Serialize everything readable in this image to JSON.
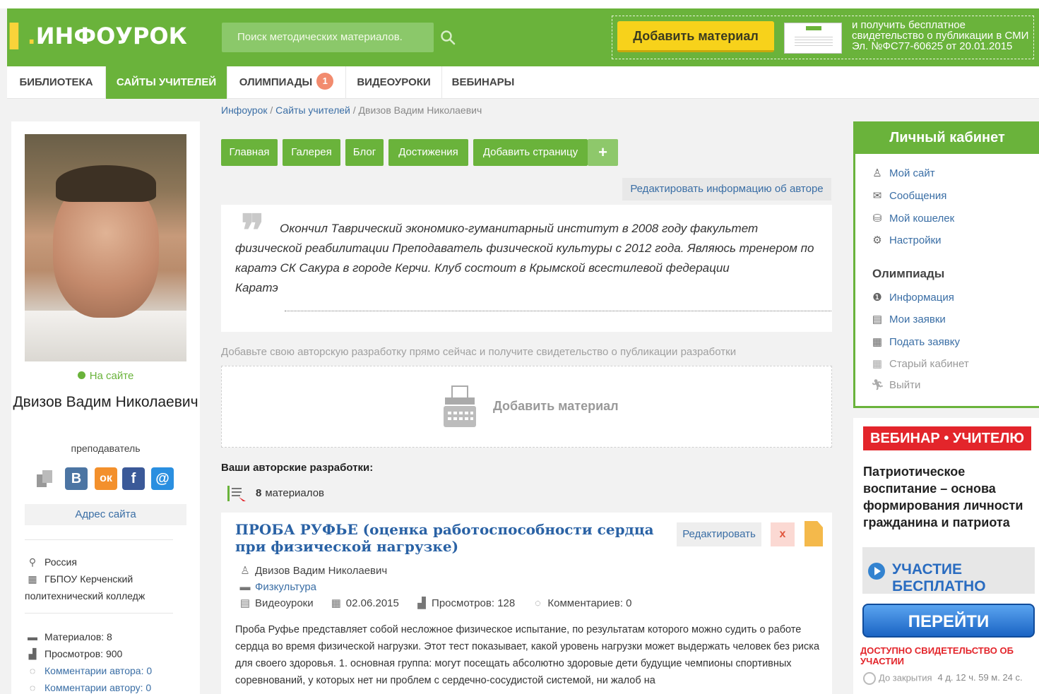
{
  "header": {
    "logo_main": "ИНФОУРОК",
    "search_placeholder": "Поиск методических материалов.",
    "add_material": "Добавить материал",
    "promo_text": "и получить бесплатное свидетельство о публикации в СМИ Эл. №ФС77-60625 от 20.01.2015"
  },
  "nav": {
    "items": [
      "БИБЛИОТЕКА",
      "САЙТЫ УЧИТЕЛЕЙ",
      "ОЛИМПИАДЫ",
      "ВИДЕОУРОКИ",
      "ВЕБИНАРЫ"
    ],
    "olymp_badge": "1"
  },
  "breadcrumb": {
    "home": "Инфоурок",
    "sep": "/",
    "sites": "Сайты учителей",
    "current": "Двизов Вадим Николаевич"
  },
  "profile": {
    "status": "На сайте",
    "name": "Двизов Вадим Николаевич",
    "role": "преподаватель",
    "social_vk": "В",
    "social_ok": "ок",
    "social_fb": "f",
    "social_mail": "@",
    "site_address": "Адрес сайта",
    "country": "Россия",
    "org": "ГБПОУ Керченский политехнический колледж",
    "materials": "Материалов: 8",
    "views": "Просмотров: 900",
    "author_comments": "Комментарии автора: 0",
    "comments_to_author": "Комментарии автору: 0"
  },
  "tabs": {
    "main": "Главная",
    "gallery": "Галерея",
    "blog": "Блог",
    "achievements": "Достижения",
    "add_page": "Добавить страницу",
    "plus": "+"
  },
  "about": {
    "edit_label": "Редактировать информацию об авторе",
    "text": "Окончил Таврический экономико-гуманитарный институт в 2008 году факультет физической реабилитации Преподаватель физической культуры с 2012 года. Являюсь тренером по каратэ СК Сакура в городе Керчи. Клуб состоит в Крымской всестилевой федерации",
    "text_last": "Каратэ"
  },
  "upload": {
    "hint": "Добавьте свою авторскую разработку прямо сейчас и получите свидетельство о публикации разработки",
    "label": "Добавить материал"
  },
  "works": {
    "title": "Ваши авторские разработки:",
    "count": "8",
    "count_label": "материалов"
  },
  "article": {
    "title": "ПРОБА РУФЬЕ (оценка работоспособности сердца при физической нагрузке)",
    "edit": "Редактировать",
    "delete": "x",
    "author": "Двизов Вадим Николаевич",
    "category": "Физкультура",
    "type": "Видеоуроки",
    "date": "02.06.2015",
    "views": "Просмотров: 128",
    "comments": "Комментариев: 0",
    "description": "Проба Руфье представляет собой несложное физическое испытание, по результатам которого можно судить о работе сердца во время физической нагрузки. Этот тест показывает, какой уровень нагрузки может выдержать человек без риска для своего здоровья. 1. основная группа: могут посещать абсолютно здоровые дети будущие чемпионы спортивных соревнований, у которых нет ни проблем с сердечно-сосудистой системой, ни жалоб на"
  },
  "cabinet": {
    "title": "Личный кабинет",
    "my_site": "Мой сайт",
    "messages": "Сообщения",
    "wallet": "Мой кошелек",
    "settings": "Настройки",
    "olymp_title": "Олимпиады",
    "info": "Информация",
    "my_requests": "Мои заявки",
    "submit_request": "Подать заявку",
    "old_cabinet": "Старый кабинет",
    "logout": "Выйти"
  },
  "webinar": {
    "tag": "ВЕБИНАР • УЧИТЕЛЮ",
    "title": "Патриотическое воспитание – основа формирования личности гражданина и патриота",
    "free": "УЧАСТИЕ БЕСПЛАТНО",
    "go": "ПЕРЕЙТИ",
    "note": "ДОСТУПНО СВИДЕТЕЛЬСТВО ОБ УЧАСТИИ",
    "timer_label": "До закрытия",
    "timer_value": "4 д. 12 ч. 59 м. 24 с."
  },
  "colors": {
    "brand_green": "#6ab33b",
    "link_blue": "#3a6ea5",
    "accent_yellow": "#f7d21b",
    "webinar_red": "#e3252b"
  }
}
